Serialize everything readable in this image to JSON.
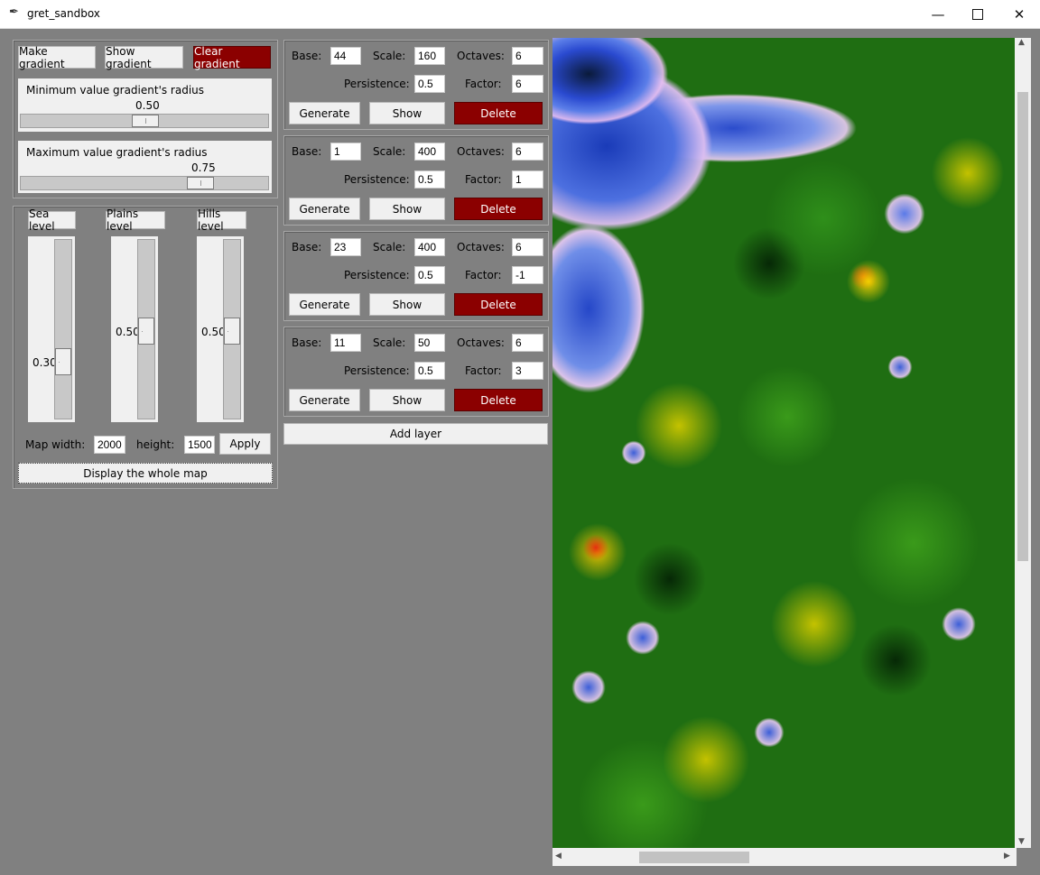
{
  "window": {
    "title": "gret_sandbox",
    "minimize_icon": "minimize-icon",
    "maximize_icon": "maximize-icon",
    "close_icon": "close-icon"
  },
  "gradient": {
    "make_label": "Make gradient",
    "show_label": "Show gradient",
    "clear_label": "Clear gradient",
    "min_label": "Minimum value gradient's radius",
    "min_value": "0.50",
    "min_fraction": 0.5,
    "max_label": "Maximum value gradient's radius",
    "max_value": "0.75",
    "max_fraction": 0.75
  },
  "levels": {
    "sea_label": "Sea level",
    "sea_value": "0.30",
    "plains_label": "Plains level",
    "plains_value": "0.50",
    "hills_label": "Hills level",
    "hills_value": "0.50"
  },
  "map_size": {
    "width_label": "Map width:",
    "width_value": "2000",
    "height_label": "height:",
    "height_value": "1500",
    "apply_label": "Apply",
    "display_label": "Display the whole map"
  },
  "layer_labels": {
    "base": "Base:",
    "scale": "Scale:",
    "octaves": "Octaves:",
    "persistence": "Persistence:",
    "factor": "Factor:",
    "generate": "Generate",
    "show": "Show",
    "delete": "Delete"
  },
  "layers": [
    {
      "base": "44",
      "scale": "160",
      "octaves": "6",
      "persistence": "0.5",
      "factor": "6"
    },
    {
      "base": "1",
      "scale": "400",
      "octaves": "6",
      "persistence": "0.5",
      "factor": "1"
    },
    {
      "base": "23",
      "scale": "400",
      "octaves": "6",
      "persistence": "0.5",
      "factor": "-1"
    },
    {
      "base": "11",
      "scale": "50",
      "octaves": "6",
      "persistence": "0.5",
      "factor": "3"
    }
  ],
  "add_layer_label": "Add layer",
  "colors": {
    "accent_red": "#8b0000",
    "background": "#808080",
    "panel": "#f0f0f0"
  },
  "scroll_icons": {
    "up": "▲",
    "down": "▼",
    "left": "◀",
    "right": "▶"
  }
}
